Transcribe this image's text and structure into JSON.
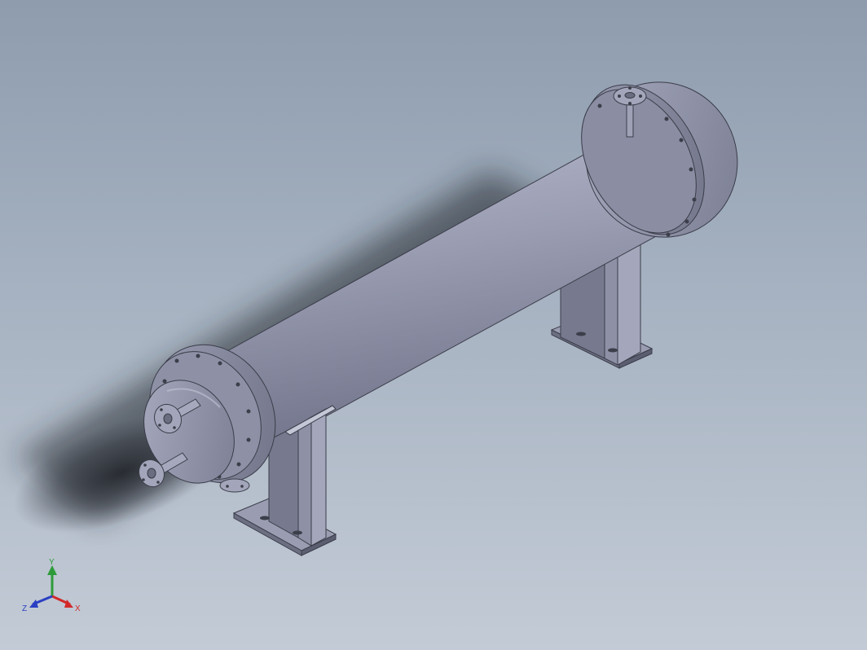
{
  "view": {
    "background_top": "#8e9cae",
    "background_bottom": "#c3cbd6",
    "model_color": "#8f92a8",
    "model_highlight": "#b4b7cb",
    "model_shadow": "#5e6175"
  },
  "triad": {
    "x_label": "X",
    "y_label": "Y",
    "z_label": "Z",
    "x_color": "#d22a2a",
    "y_color": "#2e9b3a",
    "z_color": "#2a3fc2"
  }
}
